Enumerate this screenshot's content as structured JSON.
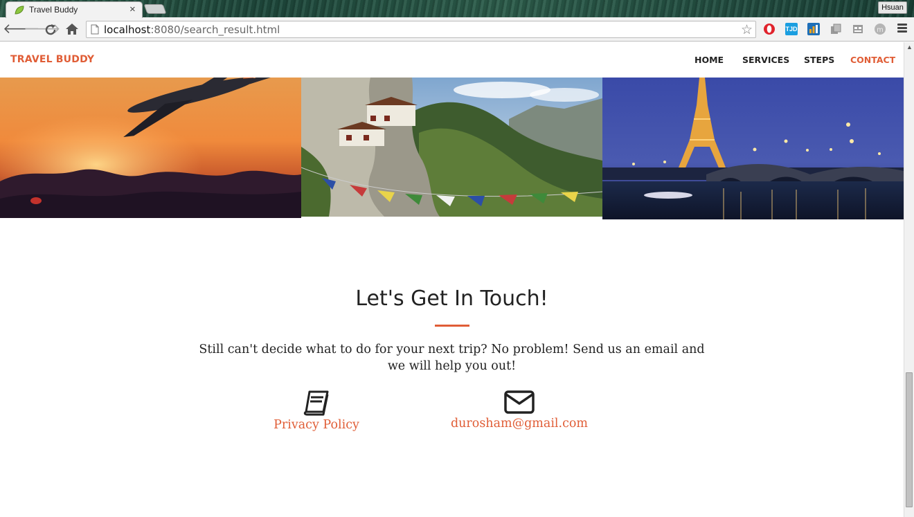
{
  "browser": {
    "tab_title": "Travel Buddy",
    "url_host": "localhost",
    "url_rest": ":8080/search_result.html",
    "profile_name": "Hsuan",
    "extensions": [
      "opera-icon",
      "tjd-icon",
      "analytics-icon",
      "puzzle-icon",
      "reader-icon",
      "avatar-icon"
    ]
  },
  "site": {
    "brand": "TRAVEL BUDDY",
    "nav": [
      {
        "label": "HOME"
      },
      {
        "label": "SERVICES"
      },
      {
        "label": "STEPS"
      },
      {
        "label": "CONTACT"
      }
    ]
  },
  "gallery": {
    "images": [
      "airplane-sunset-photo",
      "mountain-monastery-photo",
      "eiffel-tower-night-photo"
    ]
  },
  "contact": {
    "title": "Let's Get In Touch!",
    "text": "Still can't decide what to do for your next trip? No problem! Send us an email and we will help you out!",
    "privacy_label": "Privacy Policy",
    "email": "durosham@gmail.com"
  },
  "colors": {
    "accent": "#e05d36",
    "text": "#222222"
  }
}
